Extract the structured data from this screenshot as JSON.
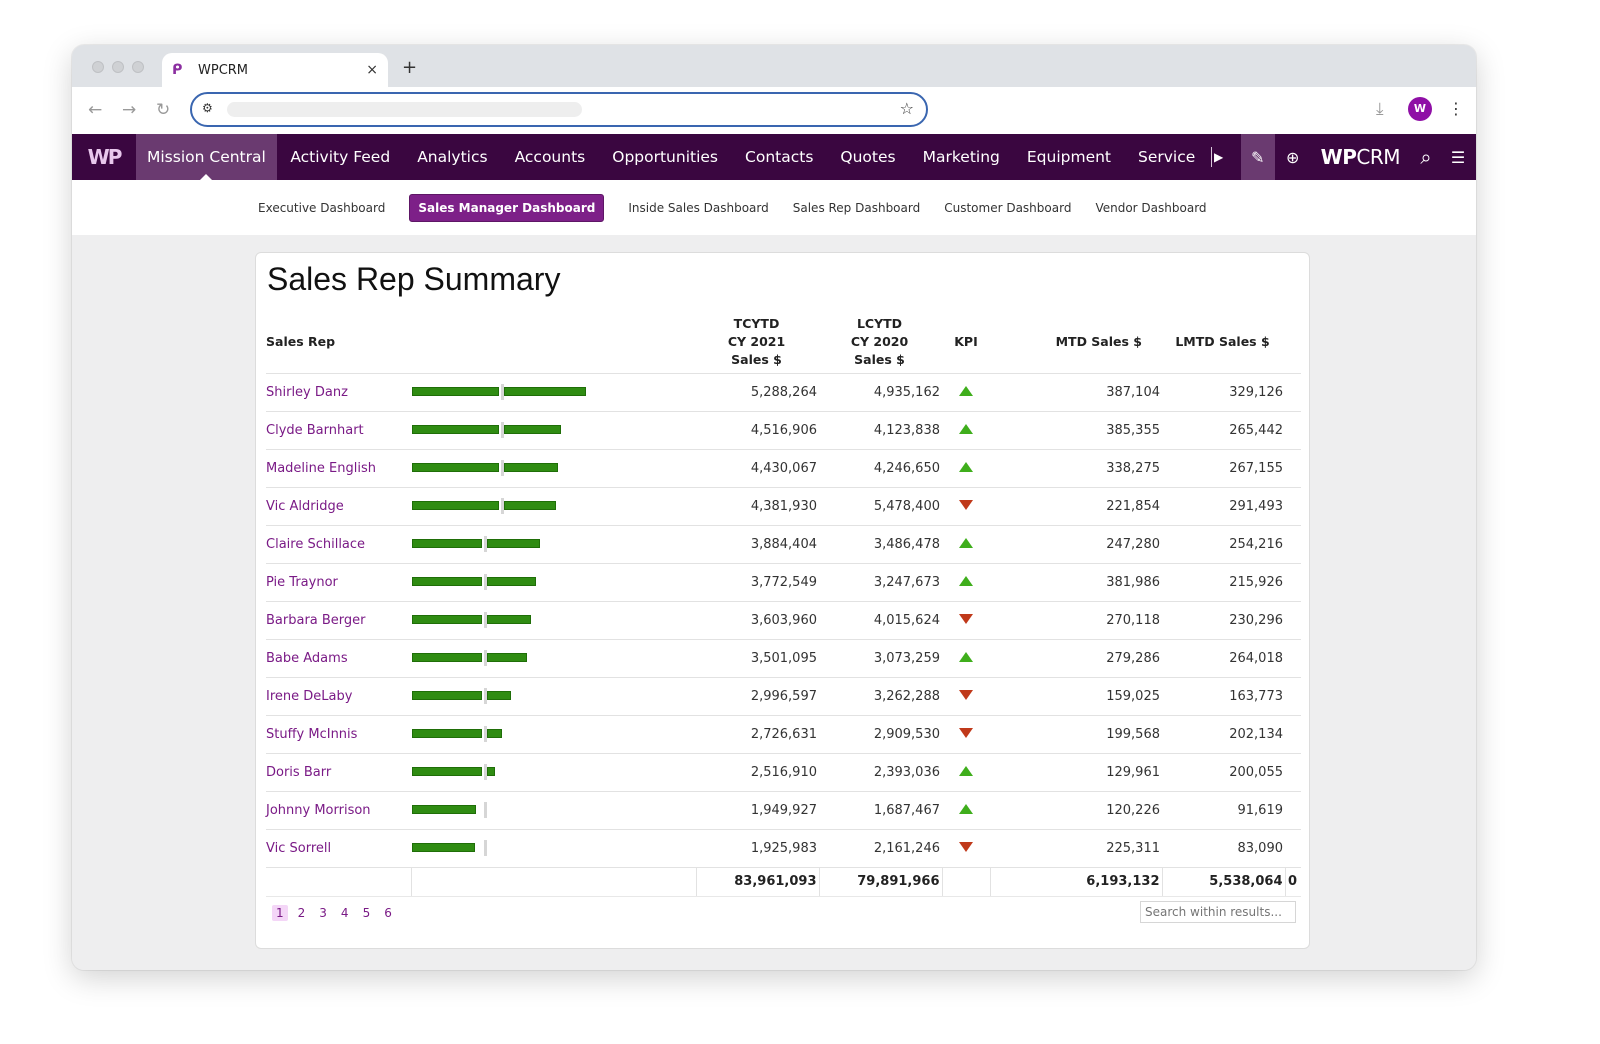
{
  "browser": {
    "tab_title": "WPCRM",
    "tab_close": "×",
    "new_tab": "+",
    "back": "←",
    "forward": "→",
    "reload": "↻",
    "site_settings_icon": "⚙",
    "bookmark_icon": "☆",
    "download_icon": "⤓",
    "profile_initial": "W",
    "menu_icon": "⋮"
  },
  "appnav": {
    "logo": "WP",
    "items": [
      {
        "label": "Mission Central",
        "active": true
      },
      {
        "label": "Activity Feed"
      },
      {
        "label": "Analytics"
      },
      {
        "label": "Accounts"
      },
      {
        "label": "Opportunities"
      },
      {
        "label": "Contacts"
      },
      {
        "label": "Quotes"
      },
      {
        "label": "Marketing"
      },
      {
        "label": "Equipment"
      },
      {
        "label": "Service"
      }
    ],
    "more_icon": "▶",
    "edit_icon": "✎",
    "add_icon": "⊕",
    "brand_bold": "WP",
    "brand_light": "CRM",
    "search_icon": "⌕",
    "list_icon": "☰"
  },
  "subnav": {
    "tabs": [
      {
        "label": "Executive Dashboard"
      },
      {
        "label": "Sales Manager Dashboard",
        "active": true
      },
      {
        "label": "Inside Sales Dashboard"
      },
      {
        "label": "Sales Rep Dashboard"
      },
      {
        "label": "Customer Dashboard"
      },
      {
        "label": "Vendor Dashboard"
      }
    ]
  },
  "card": {
    "title": "Sales Rep Summary",
    "columns": {
      "rep": "Sales Rep",
      "tcytd_1": "TCYTD",
      "tcytd_2": "CY 2021",
      "tcytd_3": "Sales $",
      "lcytd_1": "LCYTD",
      "lcytd_2": "CY 2020",
      "lcytd_3": "Sales $",
      "kpi": "KPI",
      "mtd": "MTD Sales $",
      "lmtd": "LMTD Sales $"
    },
    "bar_scale_max": 8500000,
    "bar_color": "#2f8c12",
    "kpi_up_color": "#3fae1c",
    "kpi_down_color": "#c0391a",
    "rows": [
      {
        "rep": "Shirley Danz",
        "tcytd": "5,288,264",
        "tcytd_value": 5288264,
        "target_value": 2700000,
        "lcytd": "4,935,162",
        "kpi": "up",
        "mtd": "387,104",
        "lmtd": "329,126"
      },
      {
        "rep": "Clyde Barnhart",
        "tcytd": "4,516,906",
        "tcytd_value": 4516906,
        "target_value": 2700000,
        "lcytd": "4,123,838",
        "kpi": "up",
        "mtd": "385,355",
        "lmtd": "265,442"
      },
      {
        "rep": "Madeline English",
        "tcytd": "4,430,067",
        "tcytd_value": 4430067,
        "target_value": 2700000,
        "lcytd": "4,246,650",
        "kpi": "up",
        "mtd": "338,275",
        "lmtd": "267,155"
      },
      {
        "rep": "Vic Aldridge",
        "tcytd": "4,381,930",
        "tcytd_value": 4381930,
        "target_value": 2700000,
        "lcytd": "5,478,400",
        "kpi": "down",
        "mtd": "221,854",
        "lmtd": "291,493"
      },
      {
        "rep": "Claire Schillace",
        "tcytd": "3,884,404",
        "tcytd_value": 3884404,
        "target_value": 2200000,
        "lcytd": "3,486,478",
        "kpi": "up",
        "mtd": "247,280",
        "lmtd": "254,216"
      },
      {
        "rep": "Pie Traynor",
        "tcytd": "3,772,549",
        "tcytd_value": 3772549,
        "target_value": 2200000,
        "lcytd": "3,247,673",
        "kpi": "up",
        "mtd": "381,986",
        "lmtd": "215,926"
      },
      {
        "rep": "Barbara Berger",
        "tcytd": "3,603,960",
        "tcytd_value": 3603960,
        "target_value": 2200000,
        "lcytd": "4,015,624",
        "kpi": "down",
        "mtd": "270,118",
        "lmtd": "230,296"
      },
      {
        "rep": "Babe Adams",
        "tcytd": "3,501,095",
        "tcytd_value": 3501095,
        "target_value": 2200000,
        "lcytd": "3,073,259",
        "kpi": "up",
        "mtd": "279,286",
        "lmtd": "264,018"
      },
      {
        "rep": "Irene DeLaby",
        "tcytd": "2,996,597",
        "tcytd_value": 2996597,
        "target_value": 2200000,
        "lcytd": "3,262,288",
        "kpi": "down",
        "mtd": "159,025",
        "lmtd": "163,773"
      },
      {
        "rep": "Stuffy McInnis",
        "tcytd": "2,726,631",
        "tcytd_value": 2726631,
        "target_value": 2200000,
        "lcytd": "2,909,530",
        "kpi": "down",
        "mtd": "199,568",
        "lmtd": "202,134"
      },
      {
        "rep": "Doris Barr",
        "tcytd": "2,516,910",
        "tcytd_value": 2516910,
        "target_value": 2200000,
        "lcytd": "2,393,036",
        "kpi": "up",
        "mtd": "129,961",
        "lmtd": "200,055"
      },
      {
        "rep": "Johnny Morrison",
        "tcytd": "1,949,927",
        "tcytd_value": 1949927,
        "target_value": 2200000,
        "lcytd": "1,687,467",
        "kpi": "up",
        "mtd": "120,226",
        "lmtd": "91,619"
      },
      {
        "rep": "Vic Sorrell",
        "tcytd": "1,925,983",
        "tcytd_value": 1925983,
        "target_value": 2200000,
        "lcytd": "2,161,246",
        "kpi": "down",
        "mtd": "225,311",
        "lmtd": "83,090"
      }
    ],
    "totals": {
      "tcytd": "83,961,093",
      "lcytd": "79,891,966",
      "mtd": "6,193,132",
      "lmtd": "5,538,064",
      "extra": "0"
    },
    "pager": {
      "pages": [
        "1",
        "2",
        "3",
        "4",
        "5",
        "6"
      ],
      "current": "1"
    },
    "search_placeholder": "Search within results..."
  }
}
